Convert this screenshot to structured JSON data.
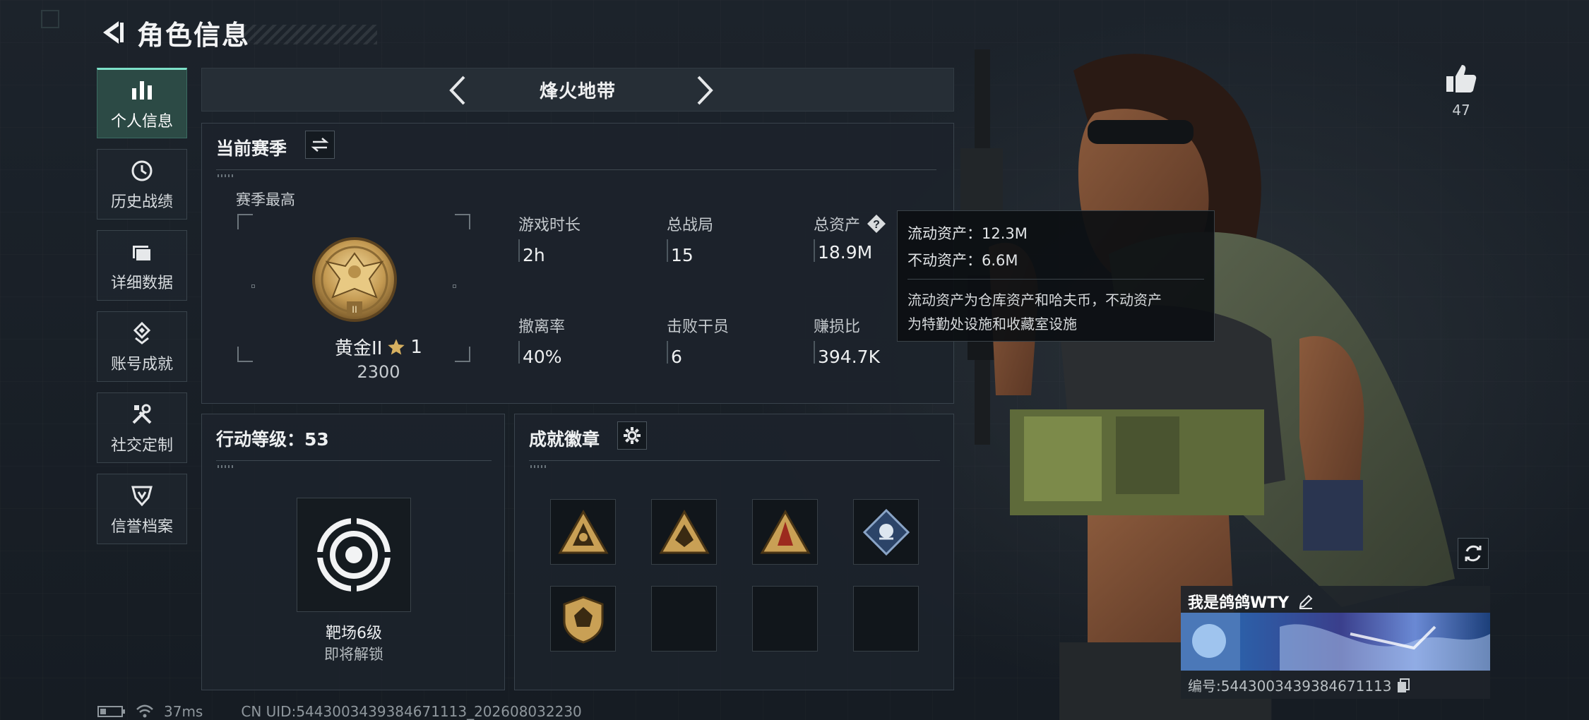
{
  "header": {
    "title": "角色信息"
  },
  "sidebar": {
    "items": [
      {
        "label": "个人信息",
        "icon": "bar-chart-icon",
        "active": true
      },
      {
        "label": "历史战绩",
        "icon": "history-icon"
      },
      {
        "label": "详细数据",
        "icon": "folder-icon"
      },
      {
        "label": "账号成就",
        "icon": "achievement-icon"
      },
      {
        "label": "社交定制",
        "icon": "tools-icon"
      },
      {
        "label": "信誉档案",
        "icon": "credit-shield-icon"
      }
    ]
  },
  "mode": {
    "name": "烽火地带"
  },
  "season": {
    "title": "当前赛季",
    "best_label": "赛季最高",
    "rank_name": "黄金II",
    "rank_stars": "1",
    "rank_emblem_numeral": "II",
    "rank_score": "2300",
    "stats": [
      {
        "label": "游戏时长",
        "value": "2h"
      },
      {
        "label": "总战局",
        "value": "15"
      },
      {
        "label": "总资产",
        "value": "18.9M"
      },
      {
        "label": "撤离率",
        "value": "40%"
      },
      {
        "label": "击败干员",
        "value": "6"
      },
      {
        "label": "赚损比",
        "value": "394.7K"
      }
    ]
  },
  "tooltip": {
    "liquid": "流动资产：12.3M",
    "fixed": "不动资产：6.6M",
    "desc_line1": "流动资产为仓库资产和哈夫币，不动资产",
    "desc_line2": "为特勤处设施和收藏室设施"
  },
  "level": {
    "title": "行动等级：53",
    "range_name": "靶场6级",
    "range_status": "即将解锁"
  },
  "badges": {
    "title": "成就徽章",
    "slots": [
      "badge-triangle-gold-1",
      "badge-triangle-gold-2",
      "badge-triangle-red",
      "badge-diamond-blue",
      "badge-shield-gold",
      "",
      "",
      ""
    ]
  },
  "profile": {
    "likes": "47",
    "player_name": "我是鸽鸽WTY",
    "player_id": "编号:5443003439384671113"
  },
  "status": {
    "latency": "37ms",
    "uid": "CN UID:5443003439384671113_202608032230"
  },
  "colors": {
    "accent": "#7de0c8",
    "gold": "#c9a55c"
  }
}
